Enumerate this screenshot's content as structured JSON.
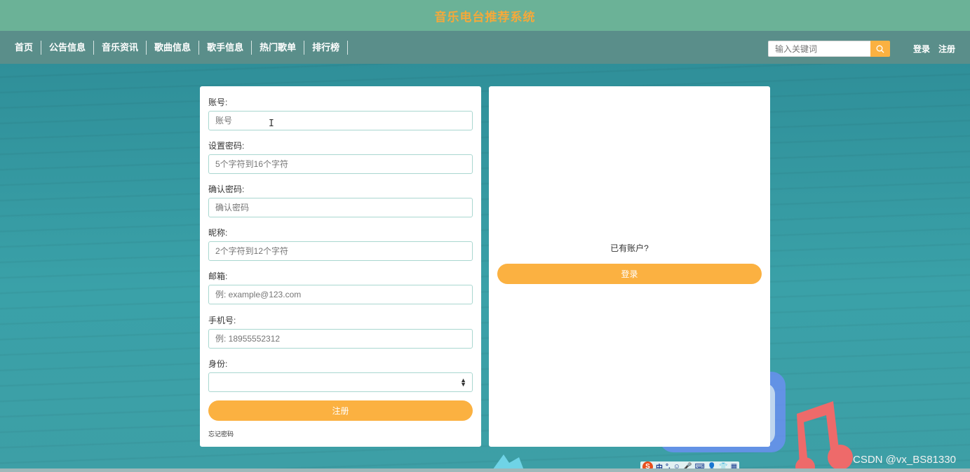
{
  "header": {
    "site_title": "音乐电台推荐系统"
  },
  "nav": {
    "items": [
      {
        "label": "首页"
      },
      {
        "label": "公告信息"
      },
      {
        "label": "音乐资讯"
      },
      {
        "label": "歌曲信息"
      },
      {
        "label": "歌手信息"
      },
      {
        "label": "热门歌单"
      },
      {
        "label": "排行榜"
      }
    ],
    "search": {
      "placeholder": "输入关键词",
      "icon": "search-icon"
    },
    "login_label": "登录",
    "register_label": "注册"
  },
  "register_form": {
    "account": {
      "label": "账号:",
      "placeholder": "账号"
    },
    "password": {
      "label": "设置密码:",
      "placeholder": "5个字符到16个字符"
    },
    "confirm_password": {
      "label": "确认密码:",
      "placeholder": "确认密码"
    },
    "nickname": {
      "label": "昵称:",
      "placeholder": "2个字符到12个字符"
    },
    "email": {
      "label": "邮箱:",
      "placeholder": "例: example@123.com"
    },
    "phone": {
      "label": "手机号:",
      "placeholder": "例: 18955552312"
    },
    "role": {
      "label": "身份:",
      "value": ""
    },
    "submit_label": "注册",
    "forgot_label": "忘记密码"
  },
  "login_panel": {
    "prompt": "已有账户?",
    "login_label": "登录"
  },
  "colors": {
    "title_bar": "#6bb297",
    "nav_bar": "#5a8e8a",
    "accent": "#fbb141",
    "title_text": "#f5a93a",
    "input_border": "#a9d7d0"
  },
  "overlay": {
    "watermark": "CSDN @vx_BS81330",
    "ime_items": [
      "中",
      "°,",
      "☺",
      "🎤",
      "⌨",
      "👤",
      "👕",
      "▦"
    ]
  }
}
